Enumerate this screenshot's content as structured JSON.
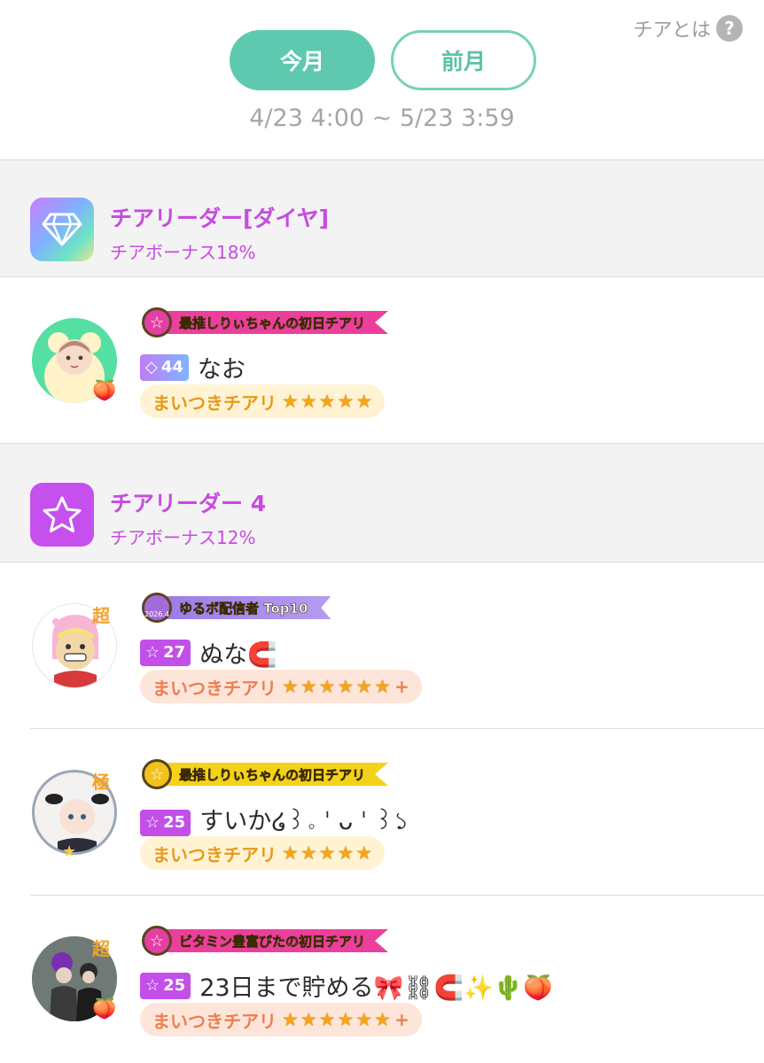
{
  "header": {
    "help_label": "チアとは",
    "help_icon": "?",
    "tabs": [
      {
        "label": "今月",
        "active": true
      },
      {
        "label": "前月",
        "active": false
      }
    ],
    "period": "4/23 4:00 ~ 5/23 3:59"
  },
  "colors": {
    "accent_green": "#5ec9ae",
    "rank_purple": "#c74be0",
    "pill_gold_text": "#e69a1c",
    "pill_orange_text": "#ec7f52"
  },
  "sections": [
    {
      "rank_icon": "diamond-icon",
      "title": "チアリーダー[ダイヤ]",
      "bonus": "チアボーナス18%",
      "entries": [
        {
          "banner": "最推しりぃちゃんの初日チアリ",
          "badge_icon": "diamond-icon",
          "level": "44",
          "name": "なお",
          "cheer_label": "まいつきチアリ",
          "stars": 5,
          "plus": false,
          "avatar_deco": "peach-icon"
        }
      ]
    },
    {
      "rank_icon": "star-icon",
      "title": "チアリーダー 4",
      "bonus": "チアボーナス12%",
      "entries": [
        {
          "banner": "ゆるボ配信者 Top10",
          "banner_year": "2026.4",
          "badge_icon": "star-icon",
          "level": "27",
          "name": "ぬな🧲",
          "cheer_label": "まいつきチアリ",
          "stars": 6,
          "plus": true,
          "avatar_deco": "super-badge",
          "avatar_deco_text": "超"
        },
        {
          "banner": "最推しりぃちゃんの初日チアリ",
          "badge_icon": "star-icon",
          "level": "25",
          "name": "すいか໒꒱。ˈ ᴗ ˈ ꒱১",
          "cheer_label": "まいつきチアリ",
          "stars": 5,
          "plus": false,
          "avatar_deco": "extreme-badge",
          "avatar_deco_text": "極"
        },
        {
          "banner": "ビタミン豊富びたの初日チアリ",
          "badge_icon": "star-icon",
          "level": "25",
          "name": "23日まで貯める🎀⛓🧲✨🌵🍑",
          "cheer_label": "まいつきチアリ",
          "stars": 6,
          "plus": true,
          "avatar_deco": "super-badge",
          "avatar_deco_text": "超"
        }
      ]
    }
  ]
}
